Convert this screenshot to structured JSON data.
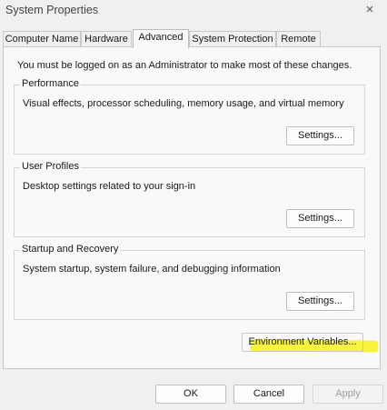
{
  "window": {
    "title": "System Properties",
    "close_icon": "×"
  },
  "tabs": [
    {
      "label": "Computer Name",
      "active": false
    },
    {
      "label": "Hardware",
      "active": false
    },
    {
      "label": "Advanced",
      "active": true
    },
    {
      "label": "System Protection",
      "active": false
    },
    {
      "label": "Remote",
      "active": false
    }
  ],
  "notice": "You must be logged on as an Administrator to make most of these changes.",
  "groups": {
    "performance": {
      "title": "Performance",
      "description": "Visual effects, processor scheduling, memory usage, and virtual memory",
      "button": "Settings..."
    },
    "user_profiles": {
      "title": "User Profiles",
      "description": "Desktop settings related to your sign-in",
      "button": "Settings..."
    },
    "startup_recovery": {
      "title": "Startup and Recovery",
      "description": "System startup, system failure, and debugging information",
      "button": "Settings..."
    }
  },
  "environment_button": "Environment Variables...",
  "footer": {
    "ok": "OK",
    "cancel": "Cancel",
    "apply": "Apply"
  },
  "colors": {
    "highlight": "#f6f000",
    "panel": "#f9f9f9",
    "chrome": "#f0f0f0"
  }
}
